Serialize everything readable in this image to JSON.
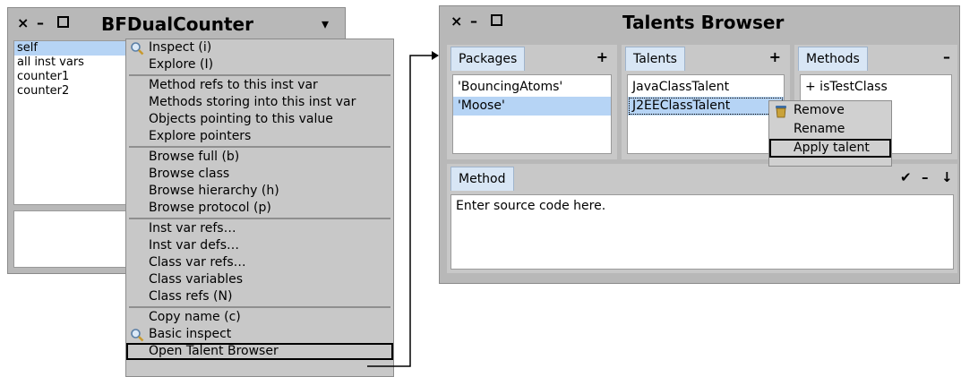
{
  "inspector": {
    "title": "BFDualCounter",
    "close": "×",
    "minimize": "–",
    "menu_arrow": "▾",
    "items": [
      "self",
      "all inst vars",
      "counter1",
      "counter2"
    ]
  },
  "context_menu": {
    "groups": [
      [
        {
          "label": "Inspect (i)",
          "icon": "magnifier-icon"
        },
        {
          "label": "Explore (I)"
        }
      ],
      [
        {
          "label": "Method refs to this inst var"
        },
        {
          "label": "Methods storing into this inst var"
        },
        {
          "label": "Objects pointing to this value"
        },
        {
          "label": "Explore pointers"
        }
      ],
      [
        {
          "label": "Browse full (b)"
        },
        {
          "label": "Browse class"
        },
        {
          "label": "Browse hierarchy (h)"
        },
        {
          "label": "Browse protocol (p)"
        }
      ],
      [
        {
          "label": "Inst var refs…"
        },
        {
          "label": "Inst var defs…"
        },
        {
          "label": "Class var refs…"
        },
        {
          "label": "Class variables"
        },
        {
          "label": "Class refs (N)"
        }
      ],
      [
        {
          "label": "Copy name (c)"
        },
        {
          "label": "Basic inspect",
          "icon": "magnifier-icon"
        },
        {
          "label": "Open Talent Browser",
          "boxed": true
        }
      ]
    ]
  },
  "browser": {
    "title": "Talents Browser",
    "close": "×",
    "minimize": "–",
    "packages": {
      "label": "Packages",
      "action": "+",
      "items": [
        "'BouncingAtoms'",
        "'Moose'"
      ]
    },
    "talents": {
      "label": "Talents",
      "action": "+",
      "items": [
        "JavaClassTalent",
        "J2EEClassTalent"
      ]
    },
    "methods": {
      "label": "Methods",
      "action": "–",
      "items": [
        "+ isTestClass"
      ]
    },
    "method_tab": {
      "label": "Method",
      "accept": "✔",
      "remove": "–",
      "down": "↓"
    },
    "editor_text": "Enter source code here."
  },
  "talent_menu": {
    "items": [
      {
        "label": "Remove",
        "icon": "trash-icon"
      },
      {
        "label": "Rename"
      },
      {
        "label": "Apply talent",
        "boxed": true
      }
    ]
  },
  "colors": {
    "window": "#b8b8b8",
    "selection": "#b6d4f5",
    "tab": "#d8e6f5"
  }
}
